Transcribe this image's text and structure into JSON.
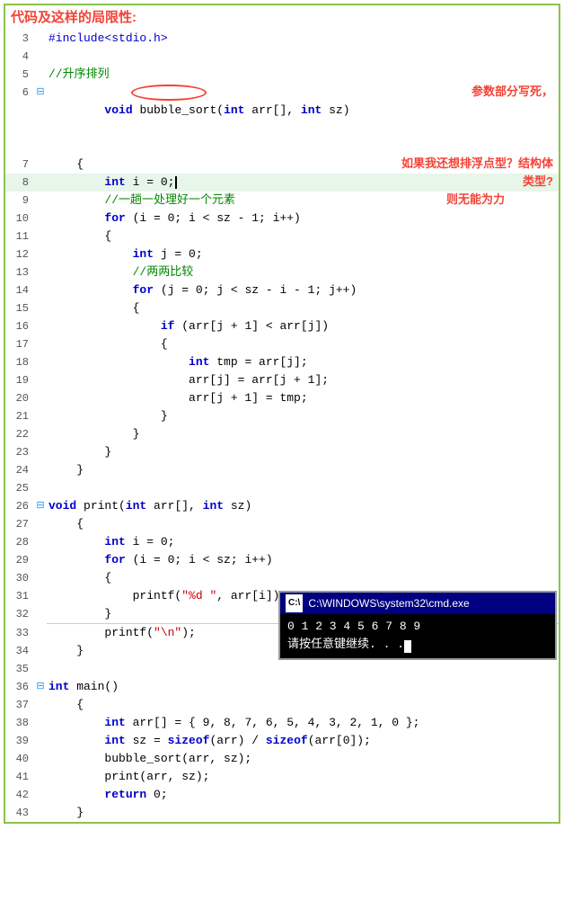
{
  "title": "代码及这样的局限性:",
  "annotations": {
    "param_dead": "参数部分写死，",
    "float_question": "如果我还想排浮点型？结构体",
    "type_question": "类型?",
    "powerless": "则无能为力"
  },
  "cmd": {
    "title": "C:\\WINDOWS\\system32\\cmd.exe",
    "output": "0 1 2 3 4 5 6 7 8 9",
    "prompt": "请按任意键继续. . ."
  },
  "lines": [
    {
      "num": 3,
      "content": "#include<stdio.h>",
      "type": "pp"
    },
    {
      "num": 4,
      "content": ""
    },
    {
      "num": 5,
      "content": "//升序排列",
      "type": "comment"
    },
    {
      "num": 6,
      "content": "void bubble_sort(int arr[], int sz)",
      "type": "code",
      "collapse": true
    },
    {
      "num": 7,
      "content": "    {"
    },
    {
      "num": 8,
      "content": "        int i = 0;",
      "cursor": true
    },
    {
      "num": 9,
      "content": "        //一趟一处理好一个元素",
      "type": "comment"
    },
    {
      "num": 10,
      "content": "        for (i = 0; i < sz - 1; i++)"
    },
    {
      "num": 11,
      "content": "        {"
    },
    {
      "num": 12,
      "content": "            int j = 0;"
    },
    {
      "num": 13,
      "content": "            //两两比较",
      "type": "comment"
    },
    {
      "num": 14,
      "content": "            for (j = 0; j < sz - i - 1; j++)"
    },
    {
      "num": 15,
      "content": "            {"
    },
    {
      "num": 16,
      "content": "                if (arr[j + 1] < arr[j])"
    },
    {
      "num": 17,
      "content": "                {"
    },
    {
      "num": 18,
      "content": "                    int tmp = arr[j];"
    },
    {
      "num": 19,
      "content": "                    arr[j] = arr[j + 1];"
    },
    {
      "num": 20,
      "content": "                    arr[j + 1] = tmp;"
    },
    {
      "num": 21,
      "content": "                }"
    },
    {
      "num": 22,
      "content": "            }"
    },
    {
      "num": 23,
      "content": "        }"
    },
    {
      "num": 24,
      "content": "    }"
    },
    {
      "num": 25,
      "content": ""
    },
    {
      "num": 26,
      "content": "void print(int arr[], int sz)",
      "collapse": true
    },
    {
      "num": 27,
      "content": "    {"
    },
    {
      "num": 28,
      "content": "        int i = 0;"
    },
    {
      "num": 29,
      "content": "        for (i = 0; i < sz; i++)"
    },
    {
      "num": 30,
      "content": "        {"
    },
    {
      "num": 31,
      "content": "            printf(\"%d \", arr[i]);"
    },
    {
      "num": 32,
      "content": "        }"
    },
    {
      "num": 33,
      "content": "        printf(\"\\n\");"
    },
    {
      "num": 34,
      "content": "    }"
    },
    {
      "num": 35,
      "content": ""
    },
    {
      "num": 36,
      "content": "int main()",
      "collapse": true
    },
    {
      "num": 37,
      "content": "    {"
    },
    {
      "num": 38,
      "content": "        int arr[] = { 9, 8, 7, 6, 5, 4, 3, 2, 1, 0 };"
    },
    {
      "num": 39,
      "content": "        int sz = sizeof(arr) / sizeof(arr[0]);"
    },
    {
      "num": 40,
      "content": "        bubble_sort(arr, sz);"
    },
    {
      "num": 41,
      "content": "        print(arr, sz);"
    },
    {
      "num": 42,
      "content": "        return 0;"
    },
    {
      "num": 43,
      "content": "    }"
    }
  ]
}
